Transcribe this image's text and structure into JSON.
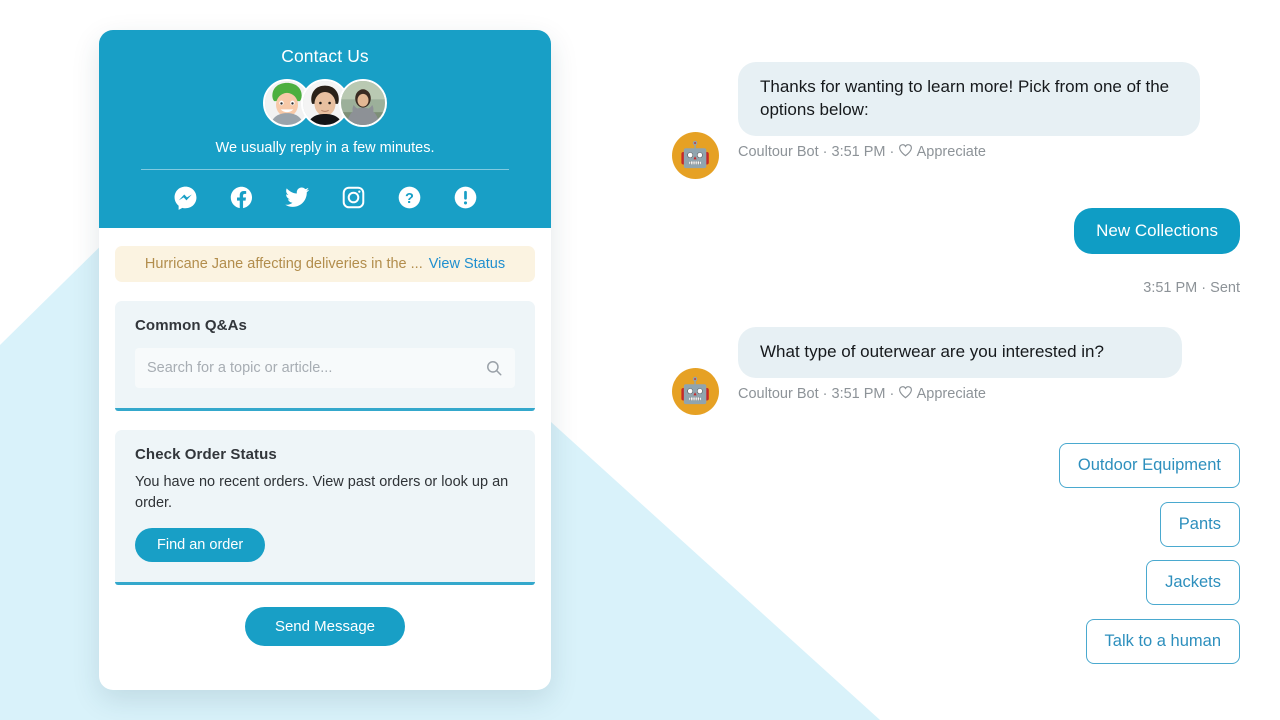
{
  "background": {
    "accent_color": "#d9f2fa",
    "brand_color": "#189fc6"
  },
  "contact_card": {
    "header": {
      "title": "Contact Us",
      "reply_note": "We usually reply in a few minutes.",
      "avatars": [
        {
          "name": "agent-avatar-1"
        },
        {
          "name": "agent-avatar-2"
        },
        {
          "name": "agent-avatar-3"
        }
      ],
      "social_icons": [
        {
          "name": "messenger-icon",
          "label": "Messenger"
        },
        {
          "name": "facebook-icon",
          "label": "Facebook"
        },
        {
          "name": "twitter-icon",
          "label": "Twitter"
        },
        {
          "name": "instagram-icon",
          "label": "Instagram"
        },
        {
          "name": "help-icon",
          "label": "Help"
        },
        {
          "name": "alert-icon",
          "label": "Alert"
        }
      ]
    },
    "alert": {
      "text": "Hurricane Jane affecting deliveries in the ...",
      "link": "View Status",
      "bg_color": "#fbf3e1",
      "text_color": "#b28d4c",
      "link_color": "#1f8fcf"
    },
    "qa_panel": {
      "title": "Common Q&As",
      "search_placeholder": "Search for a topic or article...",
      "search_value": ""
    },
    "order_panel": {
      "title": "Check Order Status",
      "body": "You have no recent orders. View past orders or look up an order.",
      "button_label": "Find an order"
    },
    "send_button_label": "Send Message"
  },
  "chat": {
    "messages": [
      {
        "type": "bot",
        "text": "Thanks for wanting to learn more! Pick from one of the options below:",
        "sender": "Coultour Bot",
        "time": "3:51 PM",
        "reaction": "Appreciate",
        "avatar_emoji": "🤖"
      },
      {
        "type": "user",
        "text": "New Collections",
        "time": "3:51 PM",
        "status": "Sent"
      },
      {
        "type": "bot",
        "text": "What type of outerwear are you interested in?",
        "sender": "Coultour Bot",
        "time": "3:51 PM",
        "reaction": "Appreciate",
        "avatar_emoji": "🤖"
      }
    ],
    "meta_separator": " · ",
    "quick_replies": [
      {
        "label": "Outdoor Equipment"
      },
      {
        "label": "Pants"
      },
      {
        "label": "Jackets"
      },
      {
        "label": "Talk to a human"
      }
    ]
  }
}
